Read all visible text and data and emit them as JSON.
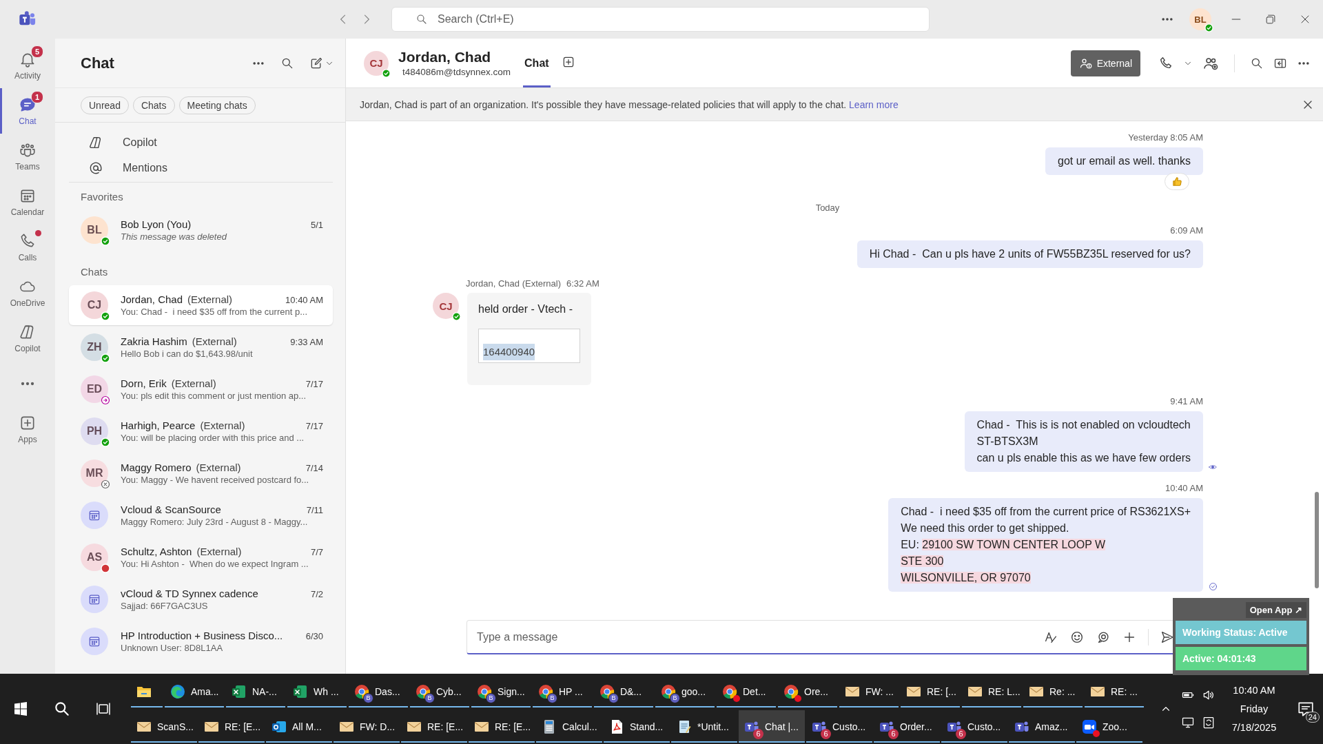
{
  "title_bar": {
    "search_placeholder": "Search (Ctrl+E)",
    "user_initials": "BL",
    "user_presence": {
      "kind": "available"
    }
  },
  "rail": [
    {
      "kind": "activity",
      "label": "Activity",
      "badge": "5",
      "alert": false,
      "selected": false
    },
    {
      "kind": "chat",
      "label": "Chat",
      "badge": "1",
      "alert": false,
      "selected": true
    },
    {
      "kind": "teams",
      "label": "Teams",
      "alert": false,
      "selected": false
    },
    {
      "kind": "calendar",
      "label": "Calendar",
      "alert": false,
      "selected": false
    },
    {
      "kind": "calls",
      "label": "Calls",
      "alert": true,
      "selected": false
    },
    {
      "kind": "onedrive",
      "label": "OneDrive",
      "alert": false,
      "selected": false
    },
    {
      "kind": "copilot",
      "label": "Copilot",
      "alert": false,
      "selected": false
    },
    {
      "kind": "more"
    },
    {
      "kind": "apps",
      "label": "Apps",
      "alert": false,
      "selected": false
    }
  ],
  "chat_list": {
    "title": "Chat",
    "filters": [
      "Unread",
      "Chats",
      "Meeting chats"
    ],
    "shortcuts": [
      {
        "kind": "copilot",
        "label": "Copilot"
      },
      {
        "kind": "mentions",
        "label": "Mentions"
      }
    ],
    "favorites_heading": "Favorites",
    "favorites": [
      {
        "kind": "person",
        "initials": "BL",
        "color": "#fde3cf",
        "name": "Bob Lyon (You)",
        "time": "5/1",
        "preview": "This message was deleted",
        "deleted": true,
        "presence": {
          "kind": "available"
        },
        "selected": false
      }
    ],
    "chats_heading": "Chats",
    "chats": [
      {
        "kind": "person",
        "initials": "CJ",
        "color": "#f4d7da",
        "name": "Jordan, Chad",
        "tag": "(External)",
        "time": "10:40 AM",
        "preview": "You: Chad -  i need $35 off from the current p...",
        "deleted": false,
        "presence": {
          "kind": "available"
        },
        "selected": true
      },
      {
        "kind": "person",
        "initials": "ZH",
        "color": "#d4dee4",
        "name": "Zakria Hashim",
        "tag": "(External)",
        "time": "9:33 AM",
        "preview": "Hello Bob i can do $1,643.98/unit",
        "deleted": false,
        "presence": {
          "kind": "available"
        },
        "selected": false
      },
      {
        "kind": "person",
        "initials": "ED",
        "color": "#f2d7e6",
        "name": "Dorn, Erik",
        "tag": "(External)",
        "time": "7/17",
        "preview": "You: pls edit this comment or just mention ap...",
        "deleted": false,
        "presence": {
          "kind": "away"
        },
        "selected": false
      },
      {
        "kind": "person",
        "initials": "PH",
        "color": "#dedcf0",
        "name": "Harhigh, Pearce",
        "tag": "(External)",
        "time": "7/17",
        "preview": "You: will be placing order with this price and ...",
        "deleted": false,
        "presence": {
          "kind": "available"
        },
        "selected": false
      },
      {
        "kind": "person",
        "initials": "MR",
        "color": "#f7dde0",
        "name": "Maggy Romero",
        "tag": "(External)",
        "time": "7/14",
        "preview": "You: Maggy - We havent received postcard fo...",
        "deleted": false,
        "presence": {
          "kind": "offline"
        },
        "selected": false
      },
      {
        "kind": "meeting",
        "color": "#dadcfb",
        "name": "Vcloud & ScanSource",
        "time": "7/11",
        "preview": "Maggy Romero: July 23rd - August 8 - Maggy...",
        "deleted": false,
        "selected": false
      },
      {
        "kind": "person",
        "initials": "AS",
        "color": "#f6dadf",
        "name": "Schultz, Ashton",
        "tag": "(External)",
        "time": "7/7",
        "preview": "You: Hi Ashton -  When do we expect Ingram ...",
        "deleted": false,
        "presence": {
          "kind": "busy"
        },
        "selected": false
      },
      {
        "kind": "meeting",
        "color": "#dadcfb",
        "name": "vCloud & TD Synnex cadence",
        "time": "7/2",
        "preview": "Sajjad: 66F7GAC3US",
        "deleted": false,
        "selected": false
      },
      {
        "kind": "meeting",
        "color": "#dadcfb",
        "name": "HP Introduction + Business Disco...",
        "time": "6/30",
        "preview": "Unknown User: 8D8L1AA",
        "deleted": false,
        "selected": false
      }
    ]
  },
  "conversation": {
    "initials": "CJ",
    "presence": {
      "kind": "available"
    },
    "name": "Jordan, Chad",
    "email": "t484086m@tdsynnex.com",
    "tabs": [
      {
        "label": "Chat",
        "selected": true
      }
    ],
    "external_label": "External",
    "banner": {
      "text": "Jordan, Chad is part of an organization. It's possible they have message-related policies that will apply to the chat.",
      "link": "Learn more"
    },
    "messages": [
      {
        "kind": "sent",
        "time": "Yesterday 8:05 AM",
        "lines": [
          {
            "text": "got ur email as well. thanks"
          }
        ],
        "reacted": true
      },
      {
        "kind": "divider",
        "text": "Today"
      },
      {
        "kind": "sent",
        "time": "6:09 AM",
        "lines": [
          {
            "text": "Hi Chad -  Can u pls have 2 units of FW55BZ35L reserved for us?"
          }
        ],
        "reacted": false
      },
      {
        "kind": "received",
        "initials": "CJ",
        "presence": {
          "kind": "available"
        },
        "sender": "Jordan, Chad (External)",
        "time": "6:32 AM",
        "lines": [
          {
            "text": "held order - Vtech -"
          }
        ],
        "quote": "164400940"
      },
      {
        "kind": "sent",
        "time": "9:41 AM",
        "lines": [
          {
            "text": "Chad -  This is is not enabled on vcloudtech"
          },
          {
            "text": "ST-BTSX3M"
          },
          {
            "text": "can u pls enable this as we have few orders"
          }
        ],
        "reacted": false,
        "receipt": {
          "kind": "seen"
        }
      },
      {
        "kind": "sent",
        "time": "10:40 AM",
        "lines": [
          {
            "text": "Chad -  i need $35 off from the current price of RS3621XS+"
          },
          {
            "text": "We need this order to get shipped."
          },
          {
            "text": "EU: ",
            "highlight": "29100 SW TOWN CENTER LOOP W"
          },
          {
            "highlight": "STE 300"
          },
          {
            "highlight": "WILSONVILLE, OR 97070"
          }
        ],
        "reacted": false,
        "receipt": {
          "kind": "delivered"
        }
      }
    ],
    "composer": {
      "placeholder": "Type a message"
    }
  },
  "status_widget": {
    "open_app": "Open App ↗",
    "status": "Working Status: Active",
    "timer": "Active: 04:01:43"
  },
  "taskbar": {
    "top_row": [
      {
        "kind": "explorer",
        "selected": false
      },
      {
        "kind": "edge",
        "label": "Ama...",
        "selected": false
      },
      {
        "kind": "excel",
        "label": "NA-...",
        "selected": false
      },
      {
        "kind": "excel",
        "label": "Wh ...",
        "selected": false
      },
      {
        "kind": "chrome",
        "label": "Das...",
        "profile": "B",
        "alert": false,
        "selected": false
      },
      {
        "kind": "chrome",
        "label": "Cyb...",
        "profile": "B",
        "alert": false,
        "selected": false
      },
      {
        "kind": "chrome",
        "label": "Sign...",
        "profile": "B",
        "alert": false,
        "selected": false
      },
      {
        "kind": "chrome",
        "label": "HP ...",
        "profile": "B",
        "alert": false,
        "selected": false
      },
      {
        "kind": "chrome",
        "label": "D&...",
        "profile": "B",
        "alert": false,
        "selected": false
      },
      {
        "kind": "chrome",
        "label": "goo...",
        "profile": "B",
        "alert": false,
        "selected": false
      },
      {
        "kind": "chrome",
        "label": "Det...",
        "alert": true,
        "selected": false
      },
      {
        "kind": "chrome",
        "label": "Ore...",
        "alert": true,
        "selected": false
      },
      {
        "kind": "mail",
        "label": "FW: ...",
        "selected": false
      },
      {
        "kind": "mail",
        "label": "RE: [...",
        "selected": false
      },
      {
        "kind": "mail",
        "label": "RE: L...",
        "selected": false
      },
      {
        "kind": "mail",
        "label": "Re: ...",
        "selected": false
      },
      {
        "kind": "mail",
        "label": "RE: ...",
        "selected": false
      }
    ],
    "bottom_row": [
      {
        "kind": "mail",
        "label": "ScanS...",
        "selected": false
      },
      {
        "kind": "mail",
        "label": "RE: [E...",
        "selected": false
      },
      {
        "kind": "outlook",
        "label": "All M...",
        "selected": false
      },
      {
        "kind": "mail",
        "label": "FW: D...",
        "selected": false
      },
      {
        "kind": "mail",
        "label": "RE: [E...",
        "selected": false
      },
      {
        "kind": "mail",
        "label": "RE: [E...",
        "selected": false
      },
      {
        "kind": "calculator",
        "label": "Calcul...",
        "selected": false
      },
      {
        "kind": "pdf",
        "label": "Stand...",
        "selected": false
      },
      {
        "kind": "notepad",
        "label": "*Untit...",
        "selected": false
      },
      {
        "kind": "teams",
        "label": "Chat |...",
        "badge": "6",
        "selected": true
      },
      {
        "kind": "teams",
        "label": "Custo...",
        "badge": "6",
        "selected": false
      },
      {
        "kind": "teams",
        "label": "Order...",
        "badge": "6",
        "selected": false
      },
      {
        "kind": "teams",
        "label": "Custo...",
        "badge": "6",
        "selected": false
      },
      {
        "kind": "teams",
        "label": "Amaz...",
        "selected": false
      },
      {
        "kind": "zoom",
        "label": "Zoo...",
        "alert": true,
        "selected": false
      }
    ],
    "tray": {
      "time": "10:40 AM",
      "day": "Friday",
      "date": "7/18/2025",
      "notifications": "24"
    }
  }
}
